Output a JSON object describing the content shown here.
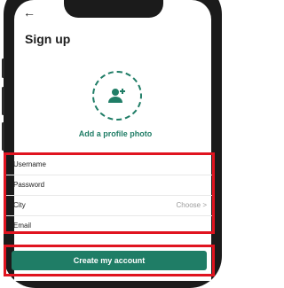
{
  "screen": {
    "back_glyph": "←",
    "title": "Sign up"
  },
  "profile_photo": {
    "label": "Add a profile photo",
    "icon": "add-user-icon"
  },
  "form": {
    "fields": [
      {
        "label": "Username"
      },
      {
        "label": "Password"
      },
      {
        "label": "City",
        "value_placeholder": "Choose",
        "chevron": ">"
      },
      {
        "label": "Email"
      }
    ]
  },
  "cta": {
    "label": "Create my account"
  },
  "colors": {
    "accent": "#1f7d66",
    "highlight": "#e0131f"
  }
}
